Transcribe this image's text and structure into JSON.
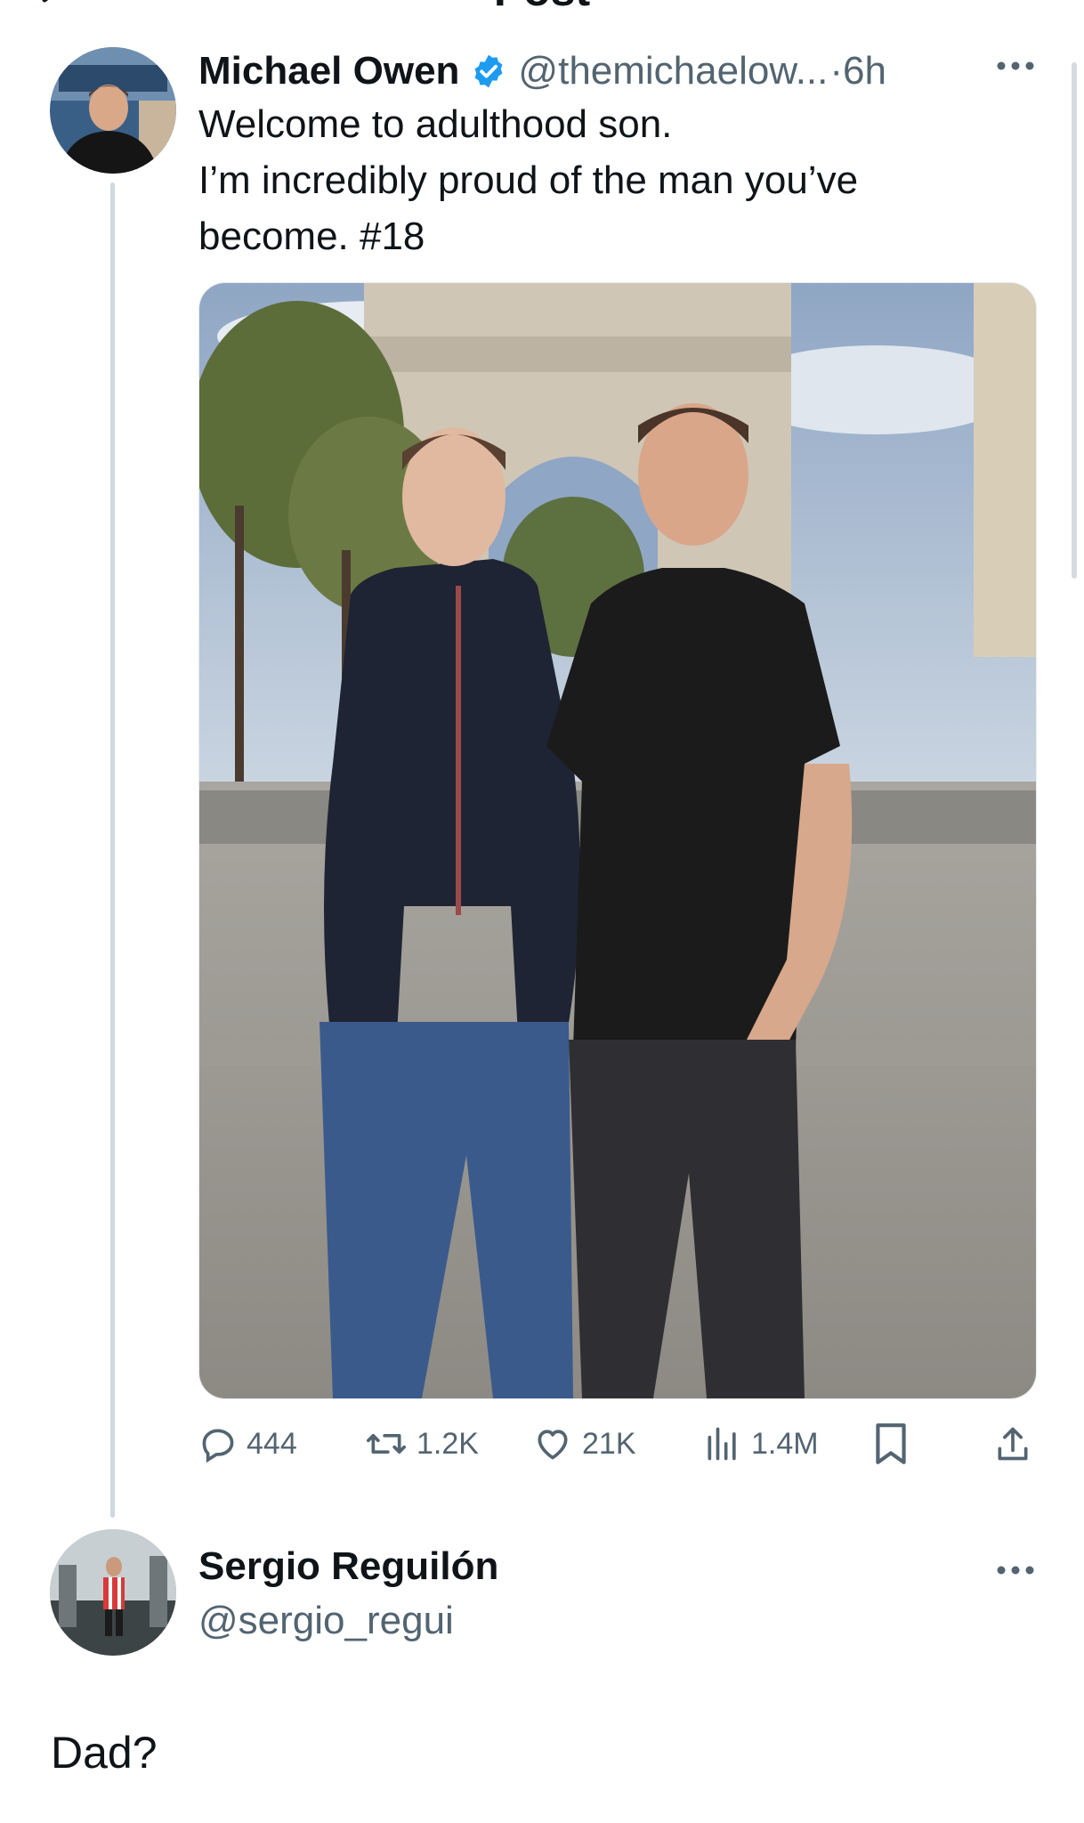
{
  "header": {
    "title": "Post"
  },
  "tweet": {
    "author_name": "Michael Owen",
    "author_handle": "@themichaelow...",
    "separator": "·",
    "time": "6h",
    "verified": true,
    "text_lines": [
      "Welcome to adulthood son.",
      "I’m incredibly proud of the man you’ve",
      "become. #18"
    ],
    "photo_icon": "photo-father-son-arc-de-triomphe",
    "actions": {
      "replies": "444",
      "reposts": "1.2K",
      "likes": "21K",
      "views": "1.4M"
    }
  },
  "reply": {
    "author_name": "Sergio Reguilón",
    "author_handle": "@sergio_regui",
    "text": "Dad?"
  },
  "icons": {
    "verified": "verified-badge-icon",
    "more": "more-icon",
    "reply": "reply-icon",
    "repost": "repost-icon",
    "like": "like-icon",
    "views": "views-icon",
    "bookmark": "bookmark-icon",
    "share": "share-icon"
  },
  "colors": {
    "verified_blue": "#1d9bf0",
    "secondary_text": "#536471",
    "primary_text": "#0f1419"
  }
}
